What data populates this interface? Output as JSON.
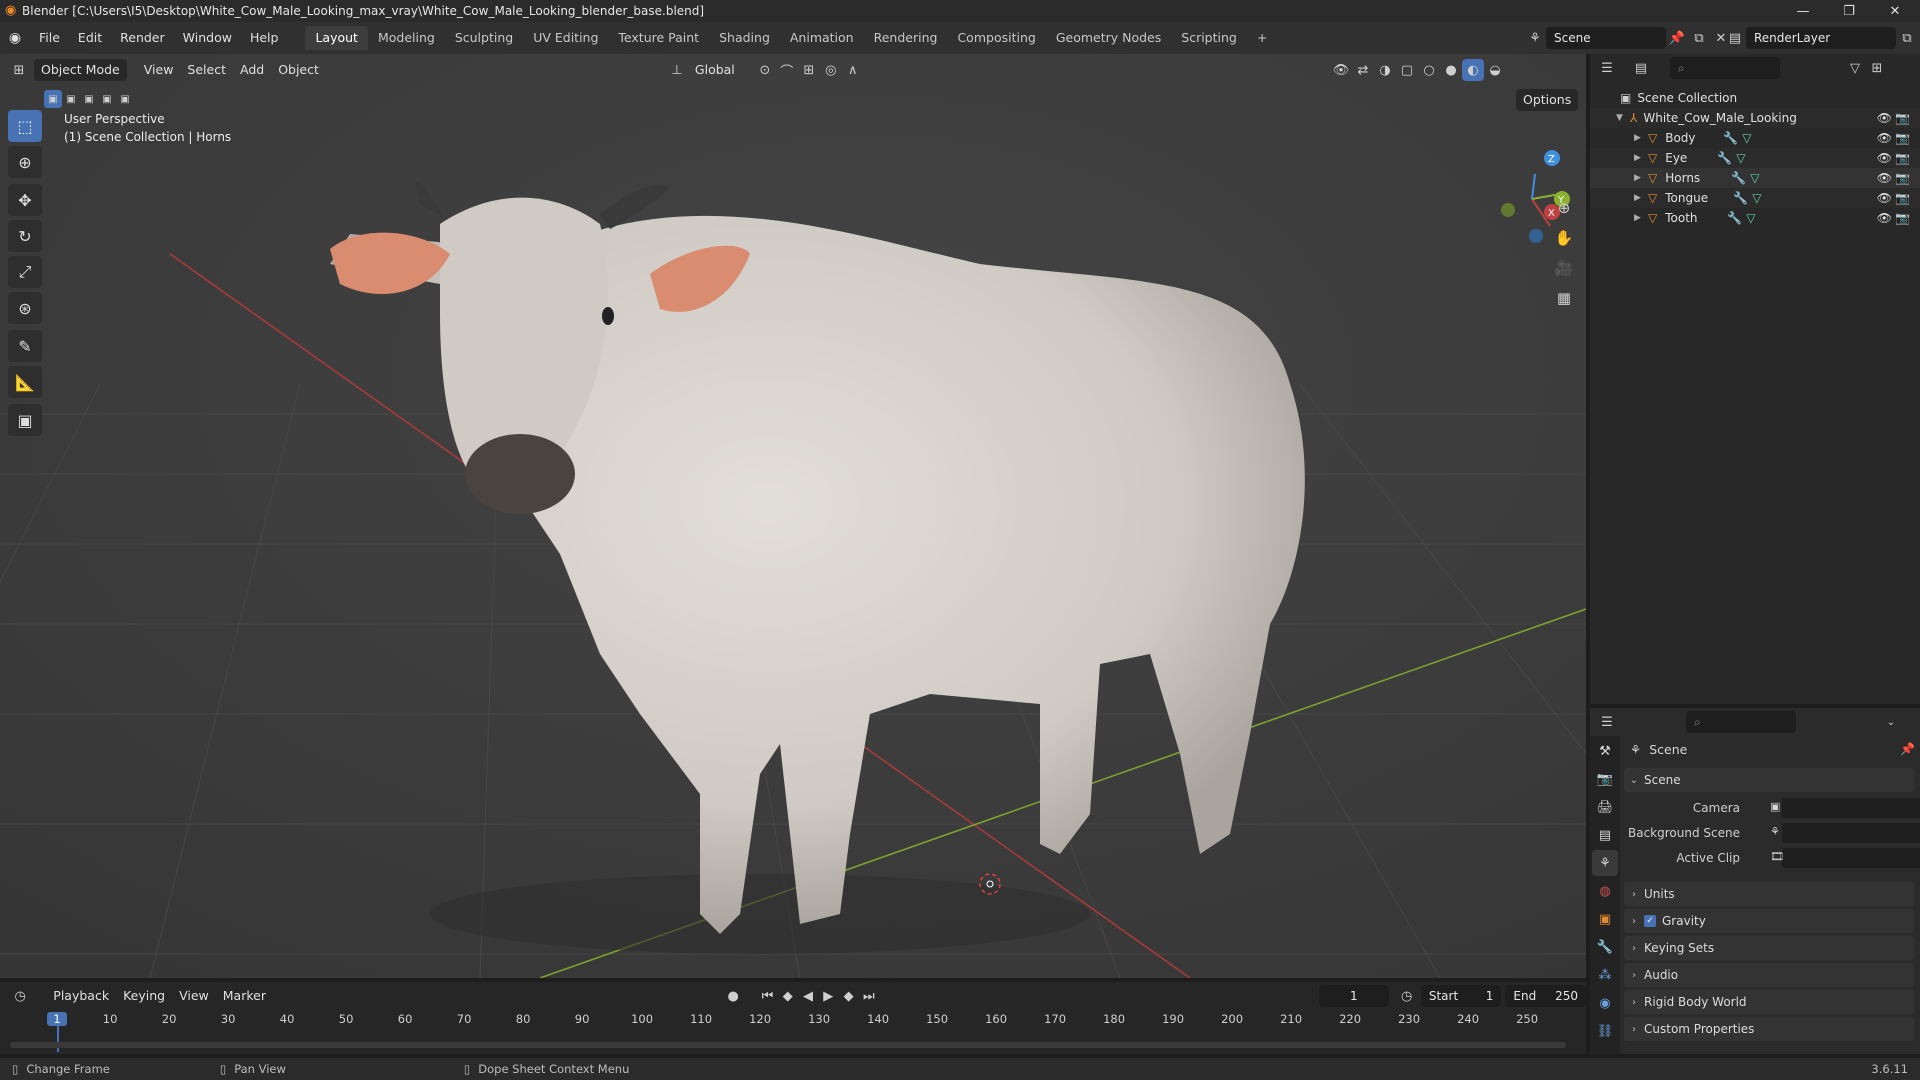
{
  "window": {
    "title": "Blender [C:\\Users\\I5\\Desktop\\White_Cow_Male_Looking_max_vray\\White_Cow_Male_Looking_blender_base.blend]",
    "controls": [
      "minimize-icon",
      "restore-icon",
      "close-icon"
    ]
  },
  "menu": [
    "File",
    "Edit",
    "Render",
    "Window",
    "Help"
  ],
  "workspaces": {
    "tabs": [
      "Layout",
      "Modeling",
      "Sculpting",
      "UV Editing",
      "Texture Paint",
      "Shading",
      "Animation",
      "Rendering",
      "Compositing",
      "Geometry Nodes",
      "Scripting"
    ],
    "active": "Layout",
    "add_label": "+"
  },
  "scene_selector": {
    "label": "Scene",
    "value": "Scene"
  },
  "view_layer": {
    "value": "RenderLayer"
  },
  "viewport": {
    "mode": "Object Mode",
    "menus": [
      "View",
      "Select",
      "Add",
      "Object"
    ],
    "orientation": "Global",
    "options_label": "Options",
    "overlay_line1": "User Perspective",
    "overlay_line2": "(1) Scene Collection | Horns",
    "gizmo_axes": [
      "X",
      "Y",
      "Z"
    ],
    "tools": [
      "select-box-icon",
      "cursor-icon",
      "move-icon",
      "rotate-icon",
      "scale-icon",
      "transform-icon",
      "annotate-icon",
      "measure-icon",
      "add-cube-icon"
    ]
  },
  "outliner": {
    "root": "Scene Collection",
    "collection": "White_Cow_Male_Looking",
    "objects": [
      "Body",
      "Eye",
      "Horns",
      "Tongue",
      "Tooth"
    ]
  },
  "properties": {
    "header": "Scene",
    "section": "Scene",
    "fields": [
      {
        "label": "Camera",
        "value": ""
      },
      {
        "label": "Background Scene",
        "value": ""
      },
      {
        "label": "Active Clip",
        "value": ""
      }
    ],
    "panels": [
      "Units",
      "Gravity",
      "Keying Sets",
      "Audio",
      "Rigid Body World",
      "Custom Properties"
    ],
    "gravity_checked": true
  },
  "timeline": {
    "menus": [
      "Playback",
      "Keying",
      "View",
      "Marker"
    ],
    "current_frame": "1",
    "start_label": "Start",
    "start": "1",
    "end_label": "End",
    "end": "250",
    "ticks": [
      "1",
      "10",
      "20",
      "30",
      "40",
      "50",
      "60",
      "70",
      "80",
      "90",
      "100",
      "110",
      "120",
      "130",
      "140",
      "150",
      "160",
      "170",
      "180",
      "190",
      "200",
      "210",
      "220",
      "230",
      "240",
      "250"
    ]
  },
  "status": {
    "items": [
      "Change Frame",
      "Pan View",
      "Dope Sheet Context Menu"
    ],
    "version": "3.6.11"
  },
  "colors": {
    "accent": "#4772b3",
    "axis_x": "#c04040",
    "axis_y": "#8bb030",
    "axis_z": "#3f8fe0",
    "frame_marker": "#4772b3"
  }
}
